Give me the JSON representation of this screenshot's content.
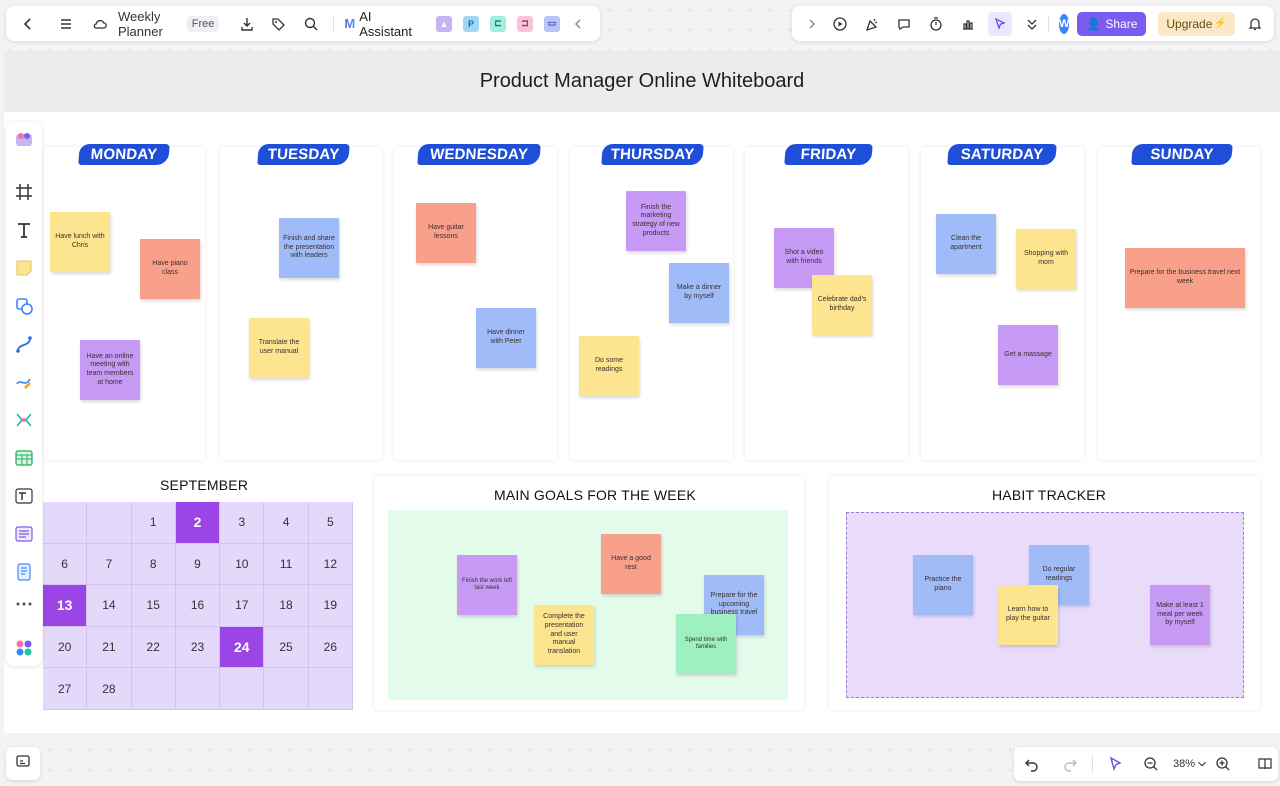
{
  "toolbar": {
    "doc_title": "Weekly Planner",
    "plan_badge": "Free",
    "ai_label": "AI Assistant",
    "share_label": "Share",
    "upgrade_label": "Upgrade",
    "avatar_initial": "W",
    "zoom_level": "38%"
  },
  "board": {
    "title": "Product Manager Online Whiteboard"
  },
  "days": [
    "MONDAY",
    "TUESDAY",
    "WEDNESDAY",
    "THURSDAY",
    "FRIDAY",
    "SATURDAY",
    "SUNDAY"
  ],
  "notes": {
    "mon": [
      "Have lunch with Chris",
      "Have piano class",
      "Have an online meeting with team members at home"
    ],
    "tue": [
      "Finish and share the presentation with leaders",
      "Translate the user manual"
    ],
    "wed": [
      "Have guitar lessons",
      "Have dinner with Peter"
    ],
    "thu": [
      "Finish the marketing strategy of new products",
      "Make a dinner by myself",
      "Do some readings"
    ],
    "fri": [
      "Shot a video with friends",
      "Celebrate dad's birthday"
    ],
    "sat": [
      "Clean the apartment",
      "Shopping with mom",
      "Get a massage"
    ],
    "sun": [
      "Prepare for the business travel next week"
    ]
  },
  "calendar": {
    "month": "SEPTEMBER",
    "cells": [
      "",
      "",
      "1",
      "2",
      "3",
      "4",
      "5",
      "6",
      "7",
      "8",
      "9",
      "10",
      "11",
      "12",
      "13",
      "14",
      "15",
      "16",
      "17",
      "18",
      "19",
      "20",
      "21",
      "22",
      "23",
      "24",
      "25",
      "26",
      "27",
      "28",
      "",
      "",
      "",
      "",
      ""
    ],
    "highlighted": [
      "2",
      "13",
      "24"
    ]
  },
  "goals": {
    "title": "MAIN GOALS FOR THE WEEK",
    "notes": [
      "Finish the work left last week",
      "Have a good rest",
      "Complete the presentation and user manual translation",
      "Prepare for the upcoming business travel",
      "Spend time with families"
    ]
  },
  "habits": {
    "title": "HABIT TRACKER",
    "notes": [
      "Practice the piano",
      "Do regular readings",
      "Learn how to play the guitar",
      "Make at least 1 meal per week by myself"
    ]
  },
  "colors": {
    "yellow": "#fde58f",
    "pink": "#f9a08b",
    "purple": "#c79af6",
    "blue": "#9fbcf8",
    "green": "#9ff0c0",
    "day_header": "#1f4fd8",
    "calendar_bg": "#e4d8fb",
    "calendar_highlight": "#9b45e6",
    "goals_bg": "#e3fbeb",
    "habits_bg": "#e9dcfb",
    "accent": "#7b5cf0"
  }
}
